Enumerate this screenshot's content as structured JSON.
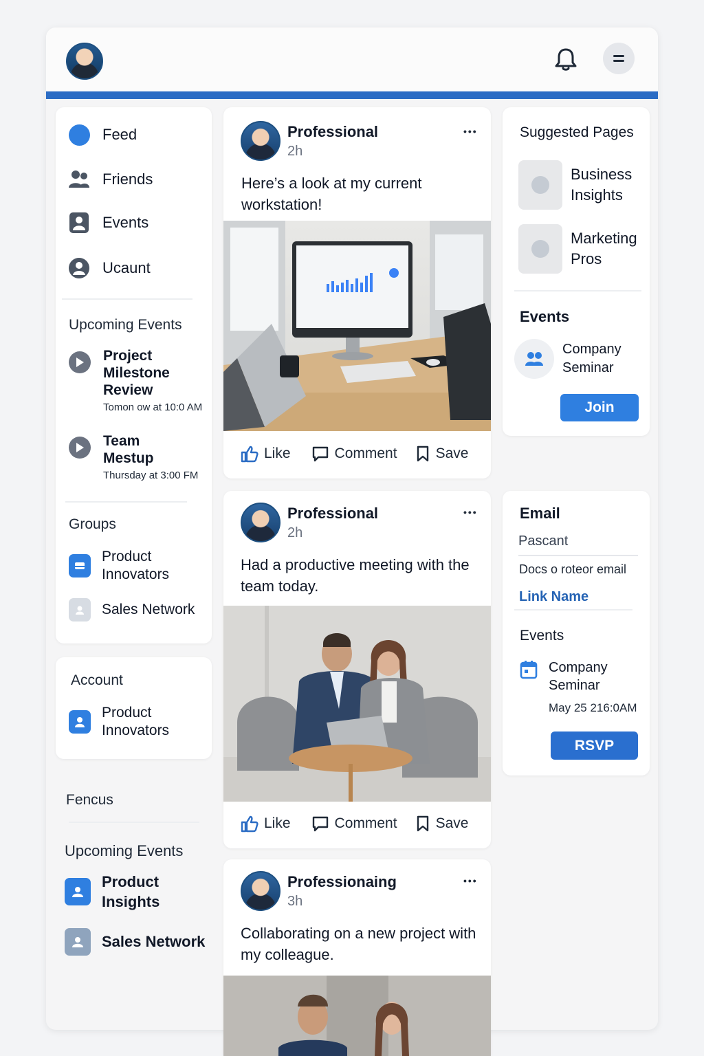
{
  "header": {
    "avatar_icon": "user-avatar",
    "bell_icon": "bell-icon",
    "menu_icon": "menu-icon",
    "accent_color": "#2b6cc4"
  },
  "sidebar": {
    "nav": [
      {
        "label": "Feed",
        "icon": "feed-dot-icon"
      },
      {
        "label": "Friends",
        "icon": "friends-icon"
      },
      {
        "label": "Events",
        "icon": "events-icon"
      },
      {
        "label": "Ucaunt",
        "icon": "account-icon"
      }
    ],
    "upcoming_title": "Upcoming Events",
    "upcoming": [
      {
        "title": "Project Milestone Review",
        "time": "Tomon ow at 10:0 AM"
      },
      {
        "title": "Team Mestup",
        "time": "Thursday at 3:00 FM"
      }
    ],
    "groups_title": "Groups",
    "groups": [
      {
        "label": "Product Innovators"
      },
      {
        "label": "Sales Network"
      }
    ],
    "account_title": "Account",
    "account_item": "Product Innovators",
    "focus_title": "Fencus",
    "upcoming2_title": "Upcoming Events",
    "upcoming2": [
      {
        "label": "Product Insights"
      },
      {
        "label": "Sales Network"
      }
    ]
  },
  "posts": [
    {
      "name": "Professional",
      "time": "2h",
      "text": "Here’s a look at my current workstation!",
      "more": "•••"
    },
    {
      "name": "Professional",
      "time": "2h",
      "text": "Had a productive meeting with the team today.",
      "more": "•••"
    },
    {
      "name": "Professionaing",
      "time": "3h",
      "text": "Collaborating on a new project with my colleague.",
      "more": "•••"
    }
  ],
  "actions": {
    "like": "Like",
    "comment": "Comment",
    "save": "Save"
  },
  "right": {
    "suggested_title": "Suggested Pages",
    "pages": [
      {
        "label": "Business Insights"
      },
      {
        "label": "Marketing Pros"
      }
    ],
    "events_title": "Events",
    "event_name": "Company Seminar",
    "join_label": "Join",
    "email_title": "Email",
    "email_field": "Pascant",
    "email_desc": "Docs o roteor email",
    "email_link": "Link Name",
    "events2_title": "Events",
    "event2_name": "Company Seminar",
    "event2_date": "May 25 216:0AM",
    "rsvp_label": "RSVP"
  }
}
